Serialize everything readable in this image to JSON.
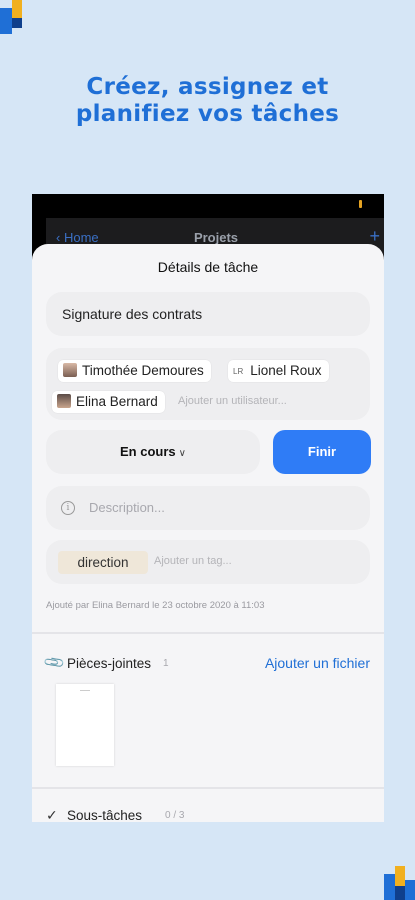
{
  "headline": {
    "line1": "Créez, assignez et",
    "line2": "planifiez vos tâches"
  },
  "colors": {
    "background": "#d6e6f6",
    "accent": "#1f6fd6",
    "finish_button": "#2f7cf6"
  },
  "navbar": {
    "back_label": "Home",
    "title": "Projets",
    "add_icon": "plus-icon"
  },
  "sheet": {
    "title": "Détails de tâche",
    "task_name": "Signature des contrats",
    "assignees": [
      {
        "name": "Timothée Demoures",
        "avatar": "photo"
      },
      {
        "name": "Lionel Roux",
        "initials": "LR"
      },
      {
        "name": "Elina Bernard",
        "avatar": "photo"
      }
    ],
    "add_user_placeholder": "Ajouter un utilisateur...",
    "status_label": "En cours",
    "finish_label": "Finir",
    "description_placeholder": "Description...",
    "tag": "direction",
    "add_tag_placeholder": "Ajouter un tag...",
    "meta": "Ajouté par Elina Bernard le 23 octobre 2020 à 11:03",
    "attachments": {
      "label": "Pièces-jointes",
      "count": "1",
      "add_label": "Ajouter un fichier"
    },
    "subtasks": {
      "label": "Sous-tâches",
      "count": "0 / 3"
    }
  }
}
